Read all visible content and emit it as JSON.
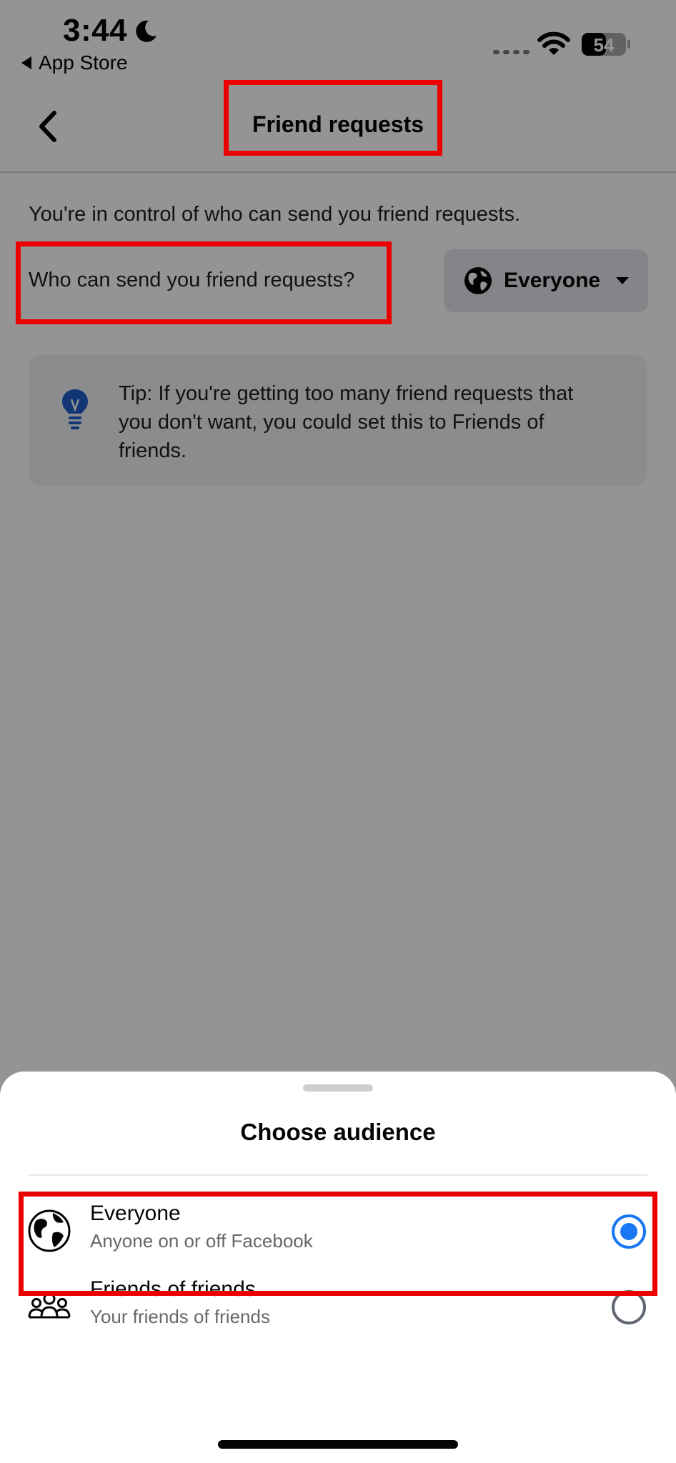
{
  "status_bar": {
    "time": "3:44",
    "back_app": "App Store",
    "battery": "54"
  },
  "nav": {
    "title": "Friend requests"
  },
  "content": {
    "intro": "You're in control of who can send you friend requests.",
    "question": "Who can send you friend requests?",
    "selected_audience": "Everyone",
    "tip": "Tip: If you're getting too many friend requests that you don't want, you could set this to Friends of friends."
  },
  "sheet": {
    "title": "Choose audience",
    "options": [
      {
        "title": "Everyone",
        "subtitle": "Anyone on or off Facebook",
        "selected": true
      },
      {
        "title": "Friends of friends",
        "subtitle": "Your friends of friends",
        "selected": false
      }
    ]
  },
  "colors": {
    "accent": "#1877f2",
    "highlight": "#ea0000",
    "tip_icon": "#1f5ec9"
  }
}
